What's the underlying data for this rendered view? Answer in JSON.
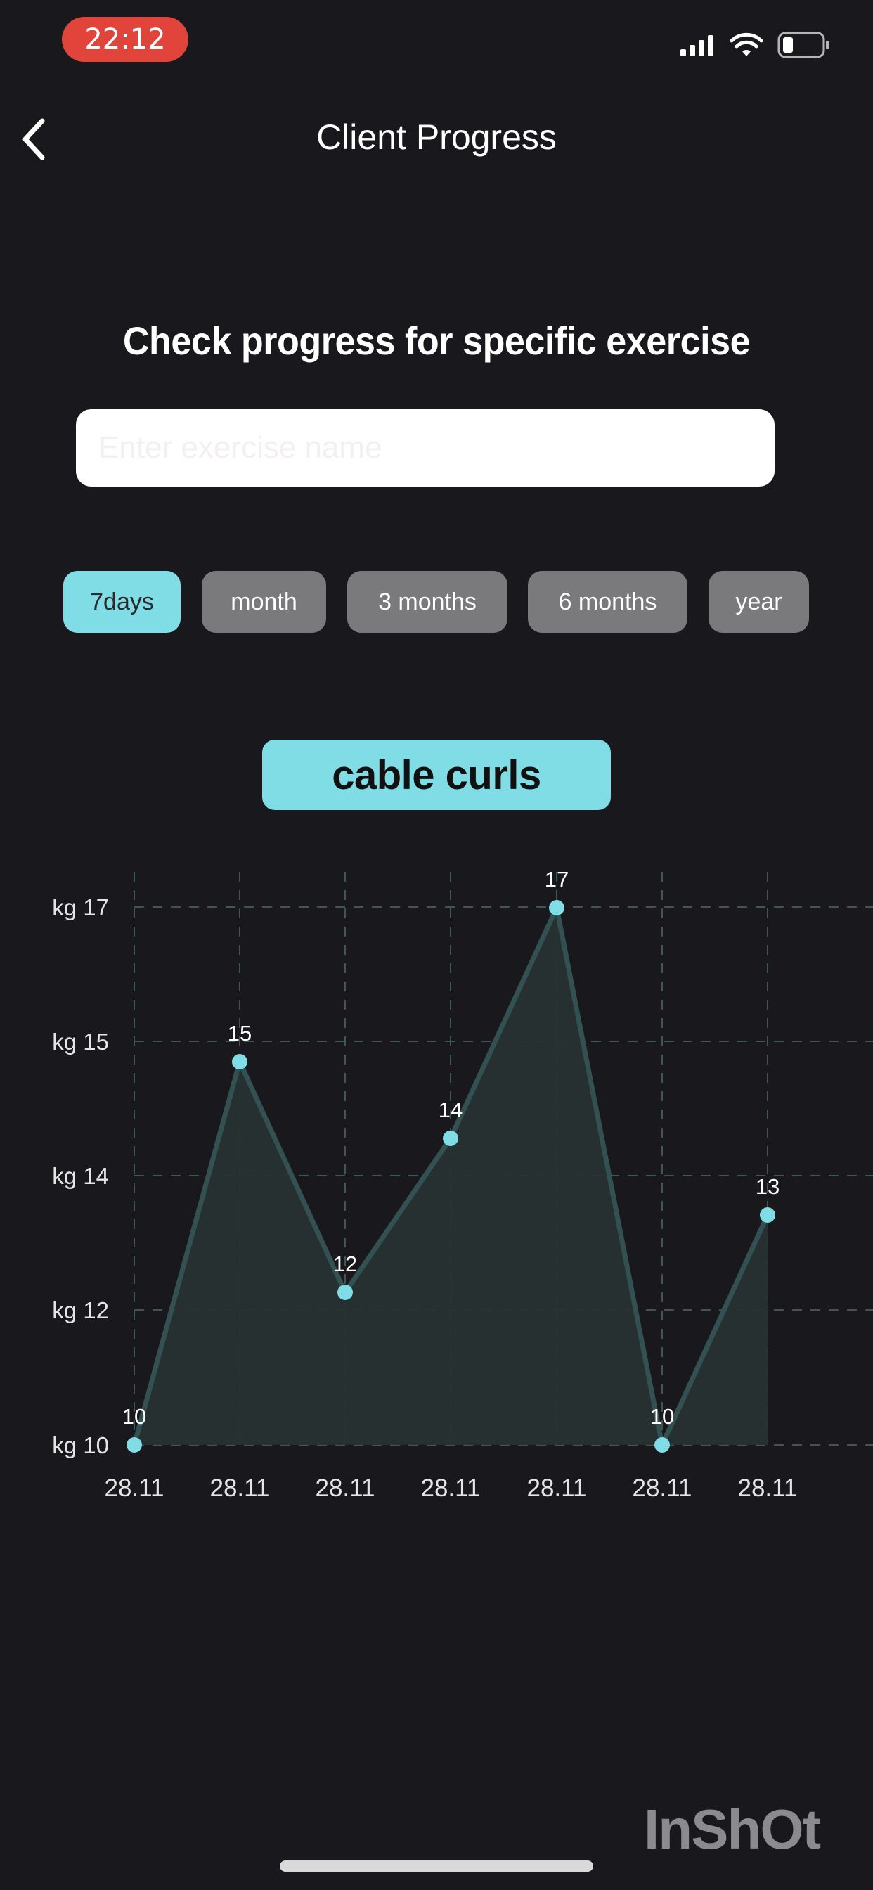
{
  "status_bar": {
    "time": "22:12",
    "icons": [
      "cellular-signal-icon",
      "wifi-icon",
      "battery-icon"
    ],
    "time_pill_color": "#e0443a"
  },
  "nav": {
    "title": "Client Progress",
    "back_icon": "chevron-left-icon"
  },
  "section_heading": "Check progress for specific exercise",
  "search": {
    "value": "",
    "placeholder": "Enter exercise name"
  },
  "ranges": [
    {
      "label": "7days",
      "active": true
    },
    {
      "label": "month",
      "active": false
    },
    {
      "label": "3 months",
      "active": false
    },
    {
      "label": "6 months",
      "active": false
    },
    {
      "label": "year",
      "active": false
    }
  ],
  "exercise_name": "cable curls",
  "colors": {
    "accent": "#80dde6",
    "pill_inactive": "#7a797c",
    "background": "#19181c"
  },
  "chart_data": {
    "type": "area",
    "x": [
      "28.11",
      "28.11",
      "28.11",
      "28.11",
      "28.11",
      "28.11",
      "28.11"
    ],
    "values": [
      10,
      15,
      12,
      14,
      17,
      10,
      13
    ],
    "y_ticks": [
      "kg 10",
      "kg 12",
      "kg 14",
      "kg 15",
      "kg 17"
    ],
    "grid": true,
    "grid_style": "dashed",
    "title": "",
    "xlabel": "",
    "ylabel": ""
  },
  "watermark": "InShOt"
}
